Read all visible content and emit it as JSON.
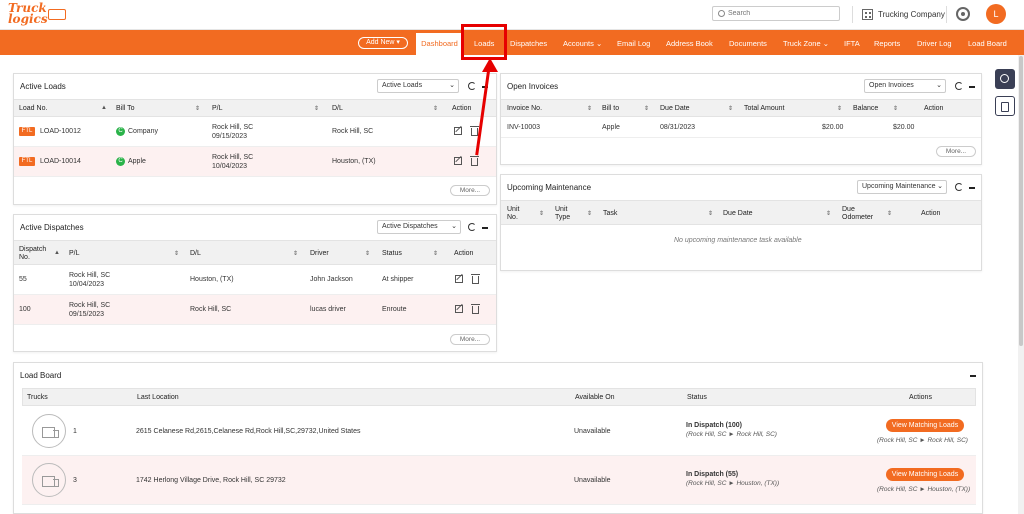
{
  "brand": {
    "logo_line1": "Truck",
    "logo_line2": "logics",
    "accent": "#f26b21",
    "highlight": "#e60000"
  },
  "header": {
    "search_placeholder": "Search",
    "company": "Trucking Company",
    "avatar_initial": "L"
  },
  "nav": {
    "add_new": "Add New",
    "items": [
      "Dashboard",
      "Loads",
      "Dispatches",
      "Accounts",
      "Email Log",
      "Address Book",
      "Documents",
      "Truck Zone",
      "IFTA",
      "Reports",
      "Driver Log",
      "Load Board"
    ],
    "active": "Dashboard"
  },
  "active_loads": {
    "title": "Active Loads",
    "select": "Active Loads",
    "columns": [
      "Load No.",
      "Bill To",
      "P/L",
      "D/L",
      "Action"
    ],
    "rows": [
      {
        "badge": "FTL",
        "load_no": "LOAD-10012",
        "bill_badge": "C",
        "bill_to": "Company",
        "pl_city": "Rock Hill, SC",
        "pl_date": "09/15/2023",
        "dl": "Rock Hill, SC"
      },
      {
        "badge": "FTL",
        "load_no": "LOAD-10014",
        "bill_badge": "C",
        "bill_to": "Apple",
        "pl_city": "Rock Hill, SC",
        "pl_date": "10/04/2023",
        "dl": "Houston, (TX)"
      }
    ],
    "more": "More..."
  },
  "active_dispatches": {
    "title": "Active Dispatches",
    "select": "Active Dispatches",
    "columns": [
      "Dispatch",
      "No.",
      "P/L",
      "D/L",
      "Driver",
      "Status",
      "Action"
    ],
    "rows": [
      {
        "no": "55",
        "pl_city": "Rock Hill, SC",
        "pl_date": "10/04/2023",
        "dl": "Houston, (TX)",
        "driver": "John Jackson",
        "status": "At shipper"
      },
      {
        "no": "100",
        "pl_city": "Rock Hill, SC",
        "pl_date": "09/15/2023",
        "dl": "Rock Hill, SC",
        "driver": "lucas driver",
        "status": "Enroute"
      }
    ],
    "more": "More..."
  },
  "open_invoices": {
    "title": "Open Invoices",
    "select": "Open Invoices",
    "columns": [
      "Invoice No.",
      "Bill to",
      "Due Date",
      "Total Amount",
      "Balance",
      "Action"
    ],
    "rows": [
      {
        "invoice_no": "INV-10003",
        "bill_to": "Apple",
        "due_date": "08/31/2023",
        "total": "$20.00",
        "balance": "$20.00"
      }
    ],
    "more": "More..."
  },
  "upcoming_maintenance": {
    "title": "Upcoming Maintenance",
    "select": "Upcoming Maintenance",
    "columns": [
      "Unit",
      "No.",
      "Unit",
      "Type",
      "Task",
      "Due Date",
      "Due",
      "Odometer",
      "Action"
    ],
    "empty": "No upcoming maintenance task available"
  },
  "load_board": {
    "title": "Load Board",
    "columns": [
      "Trucks",
      "Last Location",
      "Available On",
      "Status",
      "Actions"
    ],
    "rows": [
      {
        "truck": "1",
        "location": "2615 Celanese Rd,2615,Celanese Rd,Rock Hill,SC,29732,United States",
        "available": "Unavailable",
        "status": "In Dispatch (100)",
        "status_route": "(Rock Hill, SC ► Rock Hill, SC)",
        "button": "View Matching Loads",
        "action_route": "(Rock Hill, SC ► Rock Hill, SC)"
      },
      {
        "truck": "3",
        "location": "1742 Herlong Village Drive, Rock Hill, SC 29732",
        "available": "Unavailable",
        "status": "In Dispatch (55)",
        "status_route": "(Rock Hill, SC ► Houston, (TX))",
        "button": "View Matching Loads",
        "action_route": "(Rock Hill, SC ► Houston, (TX))"
      }
    ]
  }
}
